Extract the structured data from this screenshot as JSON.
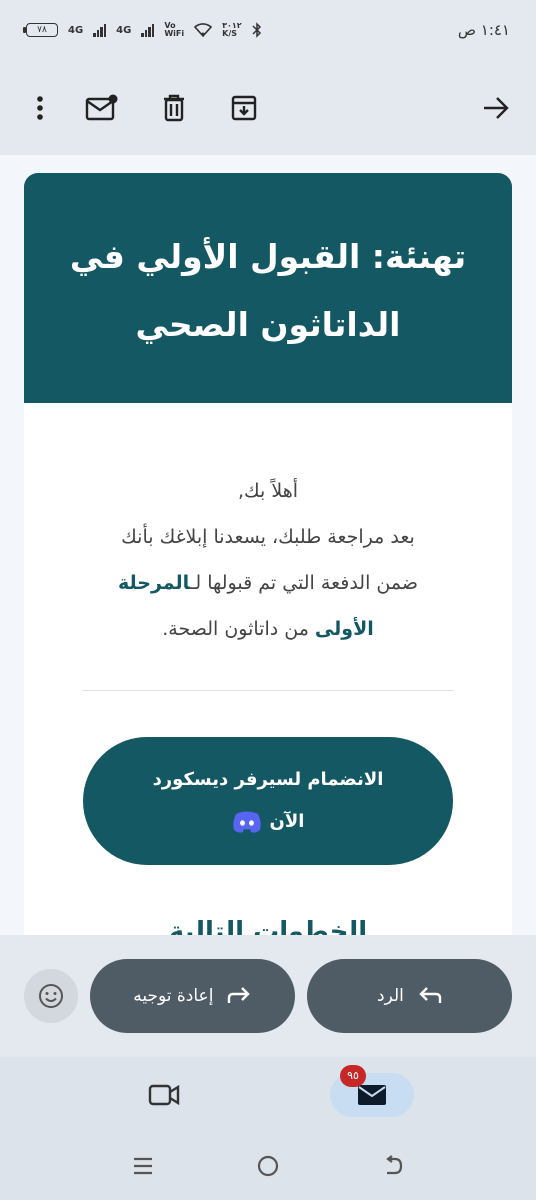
{
  "status_bar": {
    "time": "١:٤١ ص",
    "battery": "٧٨",
    "network_1": "4G",
    "network_2": "4G",
    "vowifi_top": "Vo",
    "vowifi_bottom": "WiFi",
    "speed_value": "٣٠١٢",
    "speed_unit": "K/S"
  },
  "toolbar": {
    "icons": [
      "more-vert-icon",
      "mark-unread-icon",
      "delete-icon",
      "archive-icon",
      "back-arrow-icon"
    ]
  },
  "email": {
    "header_line1": "تهنئة: القبول الأولي في",
    "header_line2": "الداتاثون الصحي",
    "greeting": "أهلاً بك,",
    "body_line1": "بعد مراجعة طلبك، يسعدنا إبلاغك بأنك",
    "body_line2_pre": "ضمن الدفعة التي تم قبولها لـ",
    "body_line2_hl": "المرحلة",
    "body_line3_hl": "الأولى",
    "body_line3_post": " من داتاثون الصحة.",
    "discord_line1": "الانضمام لسيرفر ديسكورد",
    "discord_line2": "الآن",
    "next_heading": "الخطوات التالية"
  },
  "actions": {
    "reply_label": "الرد",
    "forward_label": "إعادة توجيه"
  },
  "bottom_nav": {
    "mail_badge": "٩٥"
  },
  "colors": {
    "accent": "#145864",
    "pill": "#4f5c66",
    "discord": "#5865F2",
    "badge": "#c62828"
  }
}
